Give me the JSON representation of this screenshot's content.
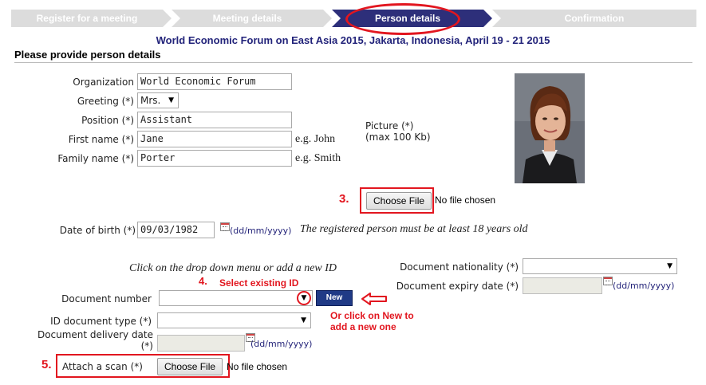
{
  "wizard": {
    "steps": [
      "Register for a meeting",
      "Meeting details",
      "Person details",
      "Confirmation"
    ],
    "active_step": "Person details"
  },
  "event_title": "World Economic Forum on East Asia 2015, Jakarta, Indonesia, April 19 - 21 2015",
  "section_title": "Please provide person details",
  "form": {
    "organization_label": "Organization",
    "organization_value": "World Economic Forum",
    "greeting_label": "Greeting (*)",
    "greeting_value": "Mrs.",
    "position_label": "Position (*)",
    "position_value": "Assistant",
    "first_name_label": "First name (*)",
    "first_name_value": "Jane",
    "first_name_example": "e.g. John",
    "family_name_label": "Family name (*)",
    "family_name_value": "Porter",
    "family_name_example": "e.g. Smith",
    "picture_label": "Picture (*)",
    "picture_note": "(max 100 Kb)",
    "choose_file_label": "Choose File",
    "no_file_text": "No file chosen",
    "dob_label": "Date of birth (*)",
    "dob_value": "09/03/1982",
    "date_format": "(dd/mm/yyyy)",
    "dob_note": "The registered person must be at least 18 years old",
    "doc_hint": "Click on the drop down menu or add a new ID",
    "doc_number_label": "Document number",
    "new_button_label": "New",
    "id_type_label": "ID document type (*)",
    "delivery_date_label_1": "Document delivery date",
    "delivery_date_label_2": "(*)",
    "doc_nationality_label": "Document nationality (*)",
    "doc_expiry_label": "Document expiry date (*)",
    "attach_scan_label": "Attach a scan (*)"
  },
  "annotations": {
    "n3": "3.",
    "n4": "4.",
    "n4_text": "Select existing ID",
    "n5": "5.",
    "or_new_1": "Or click on New to",
    "or_new_2": "add a new one"
  },
  "colors": {
    "active_step": "#2d2f7a",
    "inactive_step": "#dcdcdc",
    "annotation_red": "#e2161f",
    "title_blue": "#22237a"
  }
}
